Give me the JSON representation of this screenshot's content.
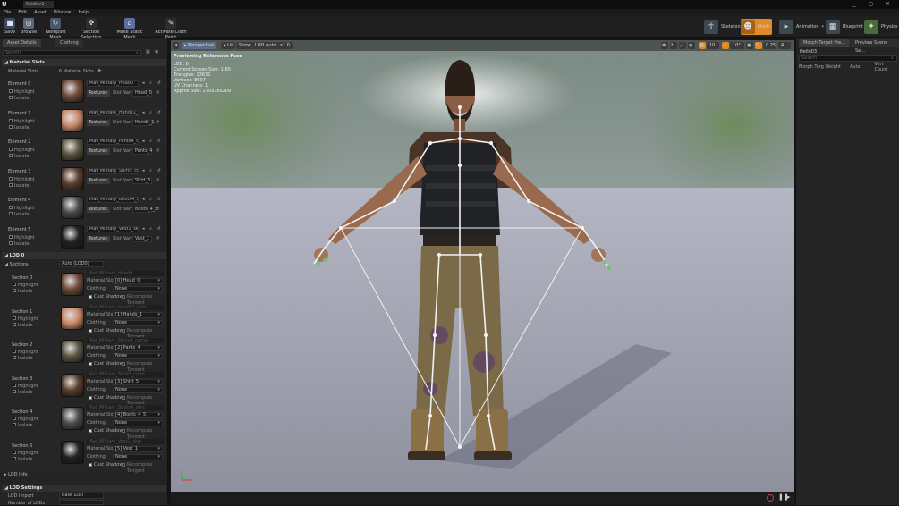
{
  "window": {
    "tab_label": "Soldier1"
  },
  "menu": [
    "File",
    "Edit",
    "Asset",
    "Window",
    "Help"
  ],
  "toolbar": {
    "buttons": [
      "Save",
      "Browse",
      "Reimport Mesh",
      "Section Selection",
      "Make Static Mesh",
      "Activate Cloth Paint"
    ],
    "modes": [
      "Skeleton",
      "Mesh",
      "Animation",
      "Blueprint",
      "Physics"
    ]
  },
  "left_panel": {
    "tabs": [
      "Asset Details",
      "Clothing"
    ],
    "search_placeholder": "Search",
    "material_slots_header": "Material Slots",
    "material_slots_label": "Material Slots",
    "material_slots_count": "6 Material Slots",
    "highlight_label": "Highlight",
    "isolate_label": "Isolate",
    "textures_label": "Textures",
    "slot_name_label": "Slot Name",
    "elements": [
      {
        "name": "Element 0",
        "material": "Mat_Military_Head0",
        "slot": "Head_0",
        "thumb": "#6e4a38"
      },
      {
        "name": "Element 1",
        "material": "Mat_Military_Hands1_skin",
        "slot": "Hands_1",
        "thumb": "#c98a6a"
      },
      {
        "name": "Element 2",
        "material": "Mat_Military_Pants4_camo",
        "slot": "Pants_4",
        "thumb": "#5b5540"
      },
      {
        "name": "Element 3",
        "material": "Mat_Military_Shirt5_cloth",
        "slot": "Shirt_5",
        "thumb": "#5a3d2c"
      },
      {
        "name": "Element 4",
        "material": "Mat_Military_Boots4_skin",
        "slot": "Boots_4_5",
        "thumb": "#4a4a4a"
      },
      {
        "name": "Element 5",
        "material": "Mat_Military_Vest1_skin",
        "slot": "Vest_1",
        "thumb": "#222222"
      }
    ],
    "lod_header": "LOD 0",
    "sections_label": "Sections",
    "sections_value": "Auto (LOD0)",
    "material_slot_label": "Material Slot",
    "clothing_label": "Clothing",
    "clothing_value": "None",
    "cast_shadows_label": "Cast Shadows",
    "recompute_tangent_label": "Recompute Tangent",
    "sections": [
      {
        "name": "Section 0",
        "material": "Mat_Military_Head0",
        "slot": "[0] Head_0",
        "thumb": "#6e4a38"
      },
      {
        "name": "Section 1",
        "material": "Mat_Military_Hands1_skin",
        "slot": "[1] Hands_1",
        "thumb": "#c98a6a"
      },
      {
        "name": "Section 2",
        "material": "Mat_Military_Pants4_camo",
        "slot": "[2] Pants_4",
        "thumb": "#5b5540"
      },
      {
        "name": "Section 3",
        "material": "Mat_Military_Shirt5_cloth",
        "slot": "[3] Shirt_5",
        "thumb": "#5a3d2c"
      },
      {
        "name": "Section 4",
        "material": "Mat_Military_Boots4_skin",
        "slot": "[4] Boots_4_5",
        "thumb": "#4a4a4a"
      },
      {
        "name": "Section 5",
        "material": "Mat_Military_Vest1_skin",
        "slot": "[5] Vest_1",
        "thumb": "#222222"
      }
    ],
    "lod_info_label": "LOD Info",
    "lod_settings_header": "LOD Settings",
    "lod_import_label": "LOD Import",
    "lod_import_value": "Base LOD",
    "number_of_lods_label": "Number of LODs"
  },
  "viewport": {
    "buttons": [
      "Perspective",
      "Lit",
      "Show",
      "LOD Auto",
      "x1.0"
    ],
    "right_values": [
      "10",
      "10°",
      "0.25",
      "4"
    ],
    "info_title": "Previewing Reference Pose",
    "info_lines": [
      "LOD: 0",
      "Current Screen Size: 1.60",
      "Triangles: 13632",
      "Vertices: 8607",
      "UV Channels: 1",
      "Approx Size: 270x78x209"
    ]
  },
  "right_panel": {
    "tabs": [
      "Morph Target Pre...",
      "Preview Scene Se..."
    ],
    "search_value": "Hello03",
    "search_placeholder": "Search",
    "columns": [
      "Morph Targ",
      "Weight",
      "Auto",
      "Vert Count"
    ]
  },
  "colors": {
    "accent": "#e08a28",
    "selected_tab": "#4a6a8a",
    "viewport_floor": "#a5a7b5"
  }
}
